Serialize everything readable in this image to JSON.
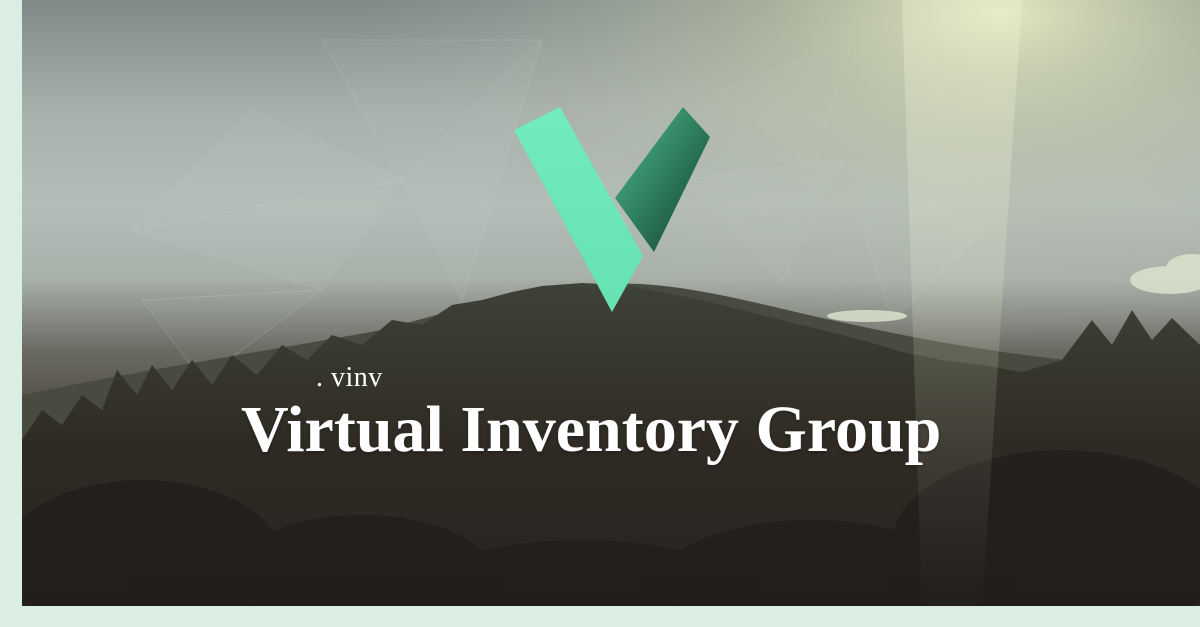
{
  "brand": {
    "tagline": ". vinv",
    "name": "Virtual Inventory Group",
    "logo_letter": "V",
    "logo_icon": "v-logo-icon",
    "colors": {
      "logo_light": "#6de8b8",
      "logo_dark_start": "#3a9a70",
      "logo_dark_end": "#0f3a2a",
      "frame": "#daeee4",
      "text": "#ffffff"
    }
  },
  "background": {
    "scene": "forest-hills-image",
    "overlay": "low-poly-pattern"
  }
}
